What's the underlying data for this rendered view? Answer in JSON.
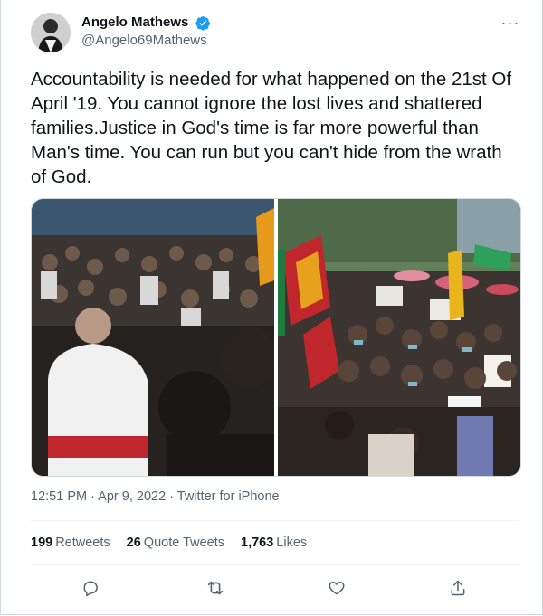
{
  "author": {
    "display_name": "Angelo Mathews",
    "handle": "@Angelo69Mathews",
    "verified": true
  },
  "tweet": {
    "text": "Accountability is needed for what happened on the 21st Of April '19. You cannot ignore the lost lives and shattered families.Justice in God's time is far more powerful than Man's time. You can run but you can't hide from the wrath of God."
  },
  "meta": {
    "time": "12:51 PM",
    "sep1": " · ",
    "date": "Apr 9, 2022",
    "sep2": " · ",
    "client": "Twitter for iPhone"
  },
  "stats": {
    "retweets_count": "199",
    "retweets_label": "Retweets",
    "quotes_count": "26",
    "quotes_label": "Quote Tweets",
    "likes_count": "1,763",
    "likes_label": "Likes"
  },
  "icons": {
    "more": "more-icon",
    "reply": "reply-icon",
    "retweet": "retweet-icon",
    "like": "like-icon",
    "share": "share-icon"
  },
  "colors": {
    "text": "#0f1419",
    "secondary": "#536471",
    "verified": "#1d9bf0",
    "border": "#cfd9de"
  }
}
